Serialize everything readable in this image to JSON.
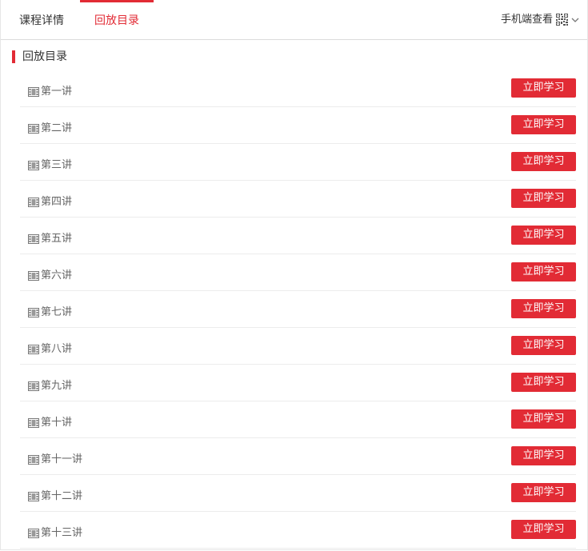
{
  "tabs": [
    {
      "label": "课程详情",
      "active": false
    },
    {
      "label": "回放目录",
      "active": true
    }
  ],
  "mobile_view": {
    "label": "手机端查看",
    "icon": "qr-code-icon",
    "dropdown_icon": "chevron-down-icon"
  },
  "section": {
    "title": "回放目录"
  },
  "lectures": [
    {
      "title": "第一讲",
      "button": "立即学习"
    },
    {
      "title": "第二讲",
      "button": "立即学习"
    },
    {
      "title": "第三讲",
      "button": "立即学习"
    },
    {
      "title": "第四讲",
      "button": "立即学习"
    },
    {
      "title": "第五讲",
      "button": "立即学习"
    },
    {
      "title": "第六讲",
      "button": "立即学习"
    },
    {
      "title": "第七讲",
      "button": "立即学习"
    },
    {
      "title": "第八讲",
      "button": "立即学习"
    },
    {
      "title": "第九讲",
      "button": "立即学习"
    },
    {
      "title": "第十讲",
      "button": "立即学习"
    },
    {
      "title": "第十一讲",
      "button": "立即学习"
    },
    {
      "title": "第十二讲",
      "button": "立即学习"
    },
    {
      "title": "第十三讲",
      "button": "立即学习"
    }
  ],
  "colors": {
    "accent": "#e22b35",
    "text": "#333333",
    "muted": "#666666",
    "divider": "#ececec"
  }
}
